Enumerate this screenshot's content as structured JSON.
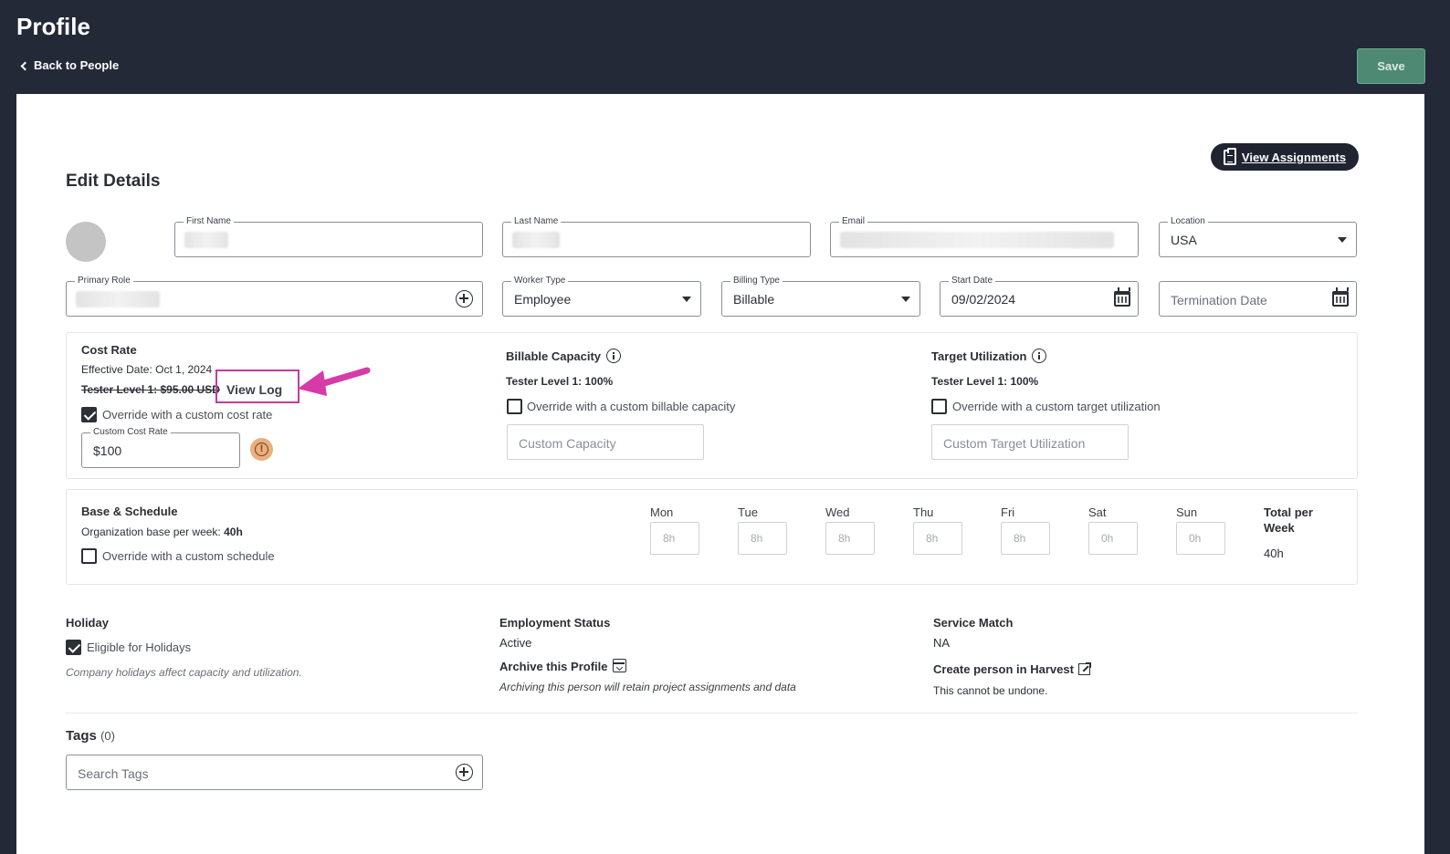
{
  "header": {
    "title": "Profile",
    "back_label": "Back to People",
    "save_label": "Save"
  },
  "toolbar": {
    "view_assignments_label": "View Assignments"
  },
  "edit_details": {
    "title": "Edit Details",
    "first_name": {
      "label": "First Name",
      "value": ""
    },
    "last_name": {
      "label": "Last Name",
      "value": ""
    },
    "email": {
      "label": "Email",
      "value": ""
    },
    "location": {
      "label": "Location",
      "value": "USA"
    },
    "primary_role": {
      "label": "Primary Role",
      "value": ""
    },
    "worker_type": {
      "label": "Worker Type",
      "value": "Employee"
    },
    "billing_type": {
      "label": "Billing Type",
      "value": "Billable"
    },
    "start_date": {
      "label": "Start Date",
      "value": "09/02/2024"
    },
    "termination_date": {
      "placeholder": "Termination Date"
    }
  },
  "cost_rate": {
    "title": "Cost Rate",
    "effective_date": "Effective Date:  Oct 1, 2024",
    "old_rate": "Tester Level 1: $95.00 USD",
    "view_log_label": "View Log",
    "override_label": "Override with a custom cost rate",
    "override_checked": true,
    "custom_label": "Custom Cost Rate",
    "custom_value": "$100"
  },
  "billable_capacity": {
    "title": "Billable Capacity",
    "level": "Tester Level 1: 100%",
    "override_label": "Override with a custom billable capacity",
    "override_checked": false,
    "placeholder": "Custom Capacity"
  },
  "target_utilization": {
    "title": "Target Utilization",
    "level": "Tester Level 1: 100%",
    "override_label": "Override with a custom target utilization",
    "override_checked": false,
    "placeholder": "Custom Target Utilization"
  },
  "schedule": {
    "title": "Base & Schedule",
    "org_base_label": "Organization base per week:",
    "org_base_value": "40h",
    "override_label": "Override with a custom schedule",
    "override_checked": false,
    "days": [
      {
        "label": "Mon",
        "value": "8h"
      },
      {
        "label": "Tue",
        "value": "8h"
      },
      {
        "label": "Wed",
        "value": "8h"
      },
      {
        "label": "Thu",
        "value": "8h"
      },
      {
        "label": "Fri",
        "value": "8h"
      },
      {
        "label": "Sat",
        "value": "0h"
      },
      {
        "label": "Sun",
        "value": "0h"
      }
    ],
    "total_label_line1": "Total per",
    "total_label_line2": "Week",
    "total_value": "40h"
  },
  "holiday": {
    "title": "Holiday",
    "eligible_label": "Eligible for Holidays",
    "eligible_checked": true,
    "note": "Company holidays affect capacity and utilization."
  },
  "employment": {
    "title": "Employment Status",
    "status": "Active",
    "archive_label": "Archive this Profile",
    "archive_note": "Archiving this person will retain project assignments and data"
  },
  "service_match": {
    "title": "Service Match",
    "value": "NA",
    "harvest_label": "Create person in Harvest",
    "harvest_note": "This cannot be undone."
  },
  "tags": {
    "title": "Tags",
    "count": "(0)",
    "placeholder": "Search Tags"
  },
  "colors": {
    "header_bg": "#232936",
    "save_bg": "#4e8a73",
    "highlight": "#c63aa0",
    "warning": "#e8b07e"
  }
}
